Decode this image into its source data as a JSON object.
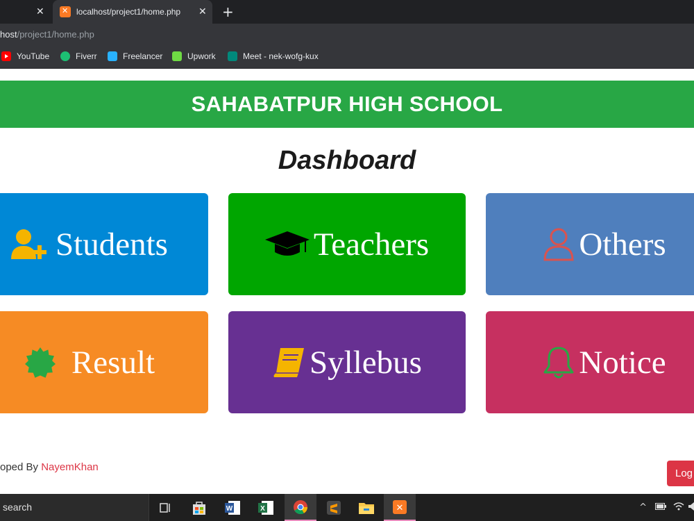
{
  "browser": {
    "tabs": [
      {
        "title": ""
      },
      {
        "title": "localhost/project1/home.php"
      }
    ],
    "close_glyph": "✕",
    "new_tab_glyph": "+",
    "url_host": "host",
    "url_path": "/project1/home.php",
    "bookmarks": [
      {
        "label": "YouTube",
        "color": "#ff0000",
        "icon": "youtube-icon"
      },
      {
        "label": "Fiverr",
        "color": "#1dbf73",
        "icon": "fiverr-icon"
      },
      {
        "label": "Freelancer",
        "color": "#29b2fe",
        "icon": "freelancer-icon"
      },
      {
        "label": "Upwork",
        "color": "#6fda44",
        "icon": "upwork-icon"
      },
      {
        "label": "Meet - nek-wofg-kux",
        "color": "#00897b",
        "icon": "meet-icon"
      }
    ]
  },
  "page": {
    "school_name": "SAHABATPUR HIGH SCHOOL",
    "title": "Dashboard",
    "header_color": "#28a745",
    "cards": [
      {
        "label": "Students",
        "color": "#0088d6",
        "icon": "user-plus-icon",
        "icon_color": "#f5b400"
      },
      {
        "label": "Teachers",
        "color": "#00a600",
        "icon": "graduation-cap-icon",
        "icon_color": "#000000"
      },
      {
        "label": "Others",
        "color": "#4f7fbd",
        "icon": "user-outline-icon",
        "icon_color": "#d9534f"
      },
      {
        "label": "Result",
        "color": "#f68b24",
        "icon": "badge-icon",
        "icon_color": "#28a745"
      },
      {
        "label": "Syllebus",
        "color": "#673092",
        "icon": "book-icon",
        "icon_color": "#f5b400"
      },
      {
        "label": "Notice",
        "color": "#c63060",
        "icon": "bell-icon",
        "icon_color": "#28a745"
      }
    ],
    "footer_prefix": "oped By ",
    "footer_author": "NayemKhan",
    "logout_label": "Log"
  },
  "taskbar": {
    "search_text": "search",
    "apps": [
      "task-view-icon",
      "store-icon",
      "word-icon",
      "excel-icon",
      "chrome-icon",
      "sublime-icon",
      "file-explorer-icon",
      "xampp-icon"
    ],
    "tray_chevron": "^"
  }
}
